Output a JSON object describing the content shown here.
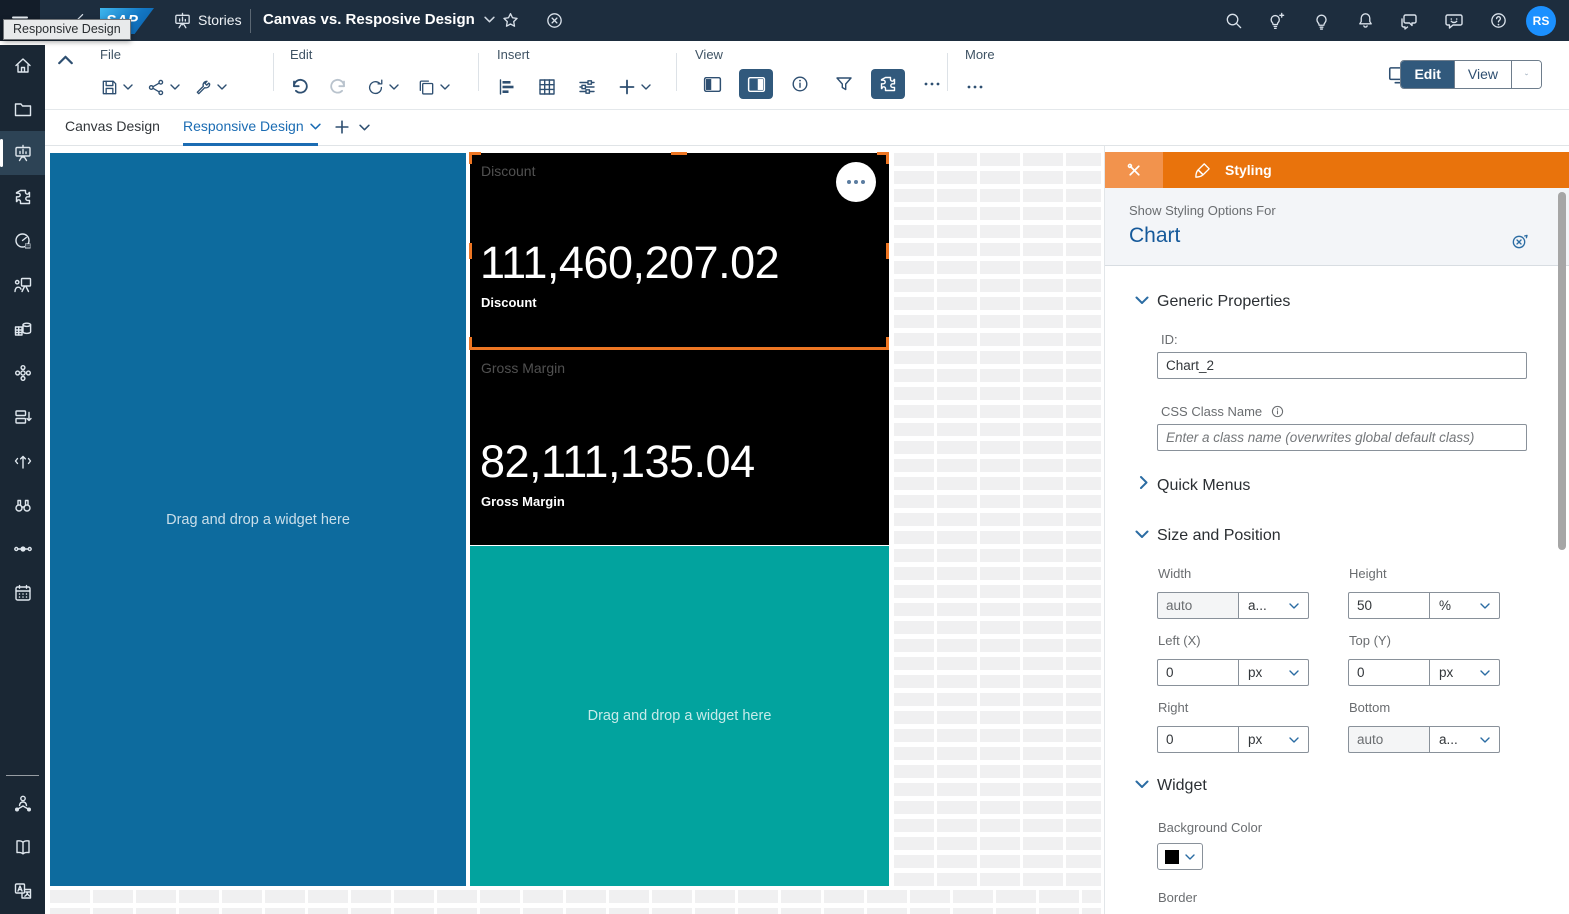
{
  "shellbar": {
    "tooltip": "Responsive Design",
    "logo": "SAP",
    "product": "Stories",
    "title": "Canvas vs. Resposive Design",
    "avatar_initials": "RS"
  },
  "toolbar": {
    "groups": {
      "file": "File",
      "edit": "Edit",
      "insert": "Insert",
      "view": "View",
      "more": "More"
    },
    "mode": {
      "edit": "Edit",
      "view": "View"
    }
  },
  "tabs": {
    "canvas": "Canvas Design",
    "responsive": "Responsive Design"
  },
  "sidebar": {
    "items": [
      "home",
      "files",
      "stories",
      "analytic-applications",
      "data-analyzer",
      "boardroom",
      "datasets",
      "modeler",
      "content-network",
      "transport",
      "explorer",
      "connections",
      "calendar",
      "security",
      "catalog",
      "translation"
    ],
    "active": "stories"
  },
  "canvas": {
    "drop_placeholder": "Drag and drop a widget here",
    "kpi_tiles": [
      {
        "title": "Discount",
        "value": "111,460,207.02",
        "label": "Discount"
      },
      {
        "title": "Gross Margin",
        "value": "82,111,135.04",
        "label": "Gross Margin"
      }
    ]
  },
  "styling_panel": {
    "tab_label": "Styling",
    "show_for": "Show Styling Options For",
    "target": "Chart",
    "generic": {
      "header": "Generic Properties",
      "id_label": "ID:",
      "id_value": "Chart_2",
      "css_label": "CSS Class Name",
      "css_placeholder": "Enter a class name (overwrites global default class)"
    },
    "quick_menus_header": "Quick Menus",
    "size": {
      "header": "Size and Position",
      "fields": [
        {
          "label": "Width",
          "value": "auto",
          "unit": "a...",
          "disabled": true
        },
        {
          "label": "Height",
          "value": "50",
          "unit": "%",
          "disabled": false
        },
        {
          "label": "Left (X)",
          "value": "0",
          "unit": "px",
          "disabled": false
        },
        {
          "label": "Top (Y)",
          "value": "0",
          "unit": "px",
          "disabled": false
        },
        {
          "label": "Right",
          "value": "0",
          "unit": "px",
          "disabled": false
        },
        {
          "label": "Bottom",
          "value": "auto",
          "unit": "a...",
          "disabled": true
        }
      ]
    },
    "widget": {
      "header": "Widget",
      "background_color_label": "Background Color",
      "background_color_value": "#000000",
      "border_label": "Border"
    }
  },
  "colors": {
    "shell_bar": "#1d2d3e",
    "sidebar": "#1a2734",
    "accent_orange": "#e9730c",
    "selection_orange": "#ee7623",
    "active_toggle_blue": "#31597c",
    "link_blue": "#1b6cb3",
    "panel_blue_widget": "#0d6b9e",
    "panel_teal_widget": "#02a39e",
    "kpi_tile_background": "#000000",
    "avatar_blue": "#1b90ff"
  },
  "icons": {
    "star": "☆",
    "close": "⊗",
    "help": "?",
    "plus": "+",
    "collapse": "^",
    "ellipsis": "•••",
    "chevron_down": "⌄",
    "back": "‹"
  }
}
